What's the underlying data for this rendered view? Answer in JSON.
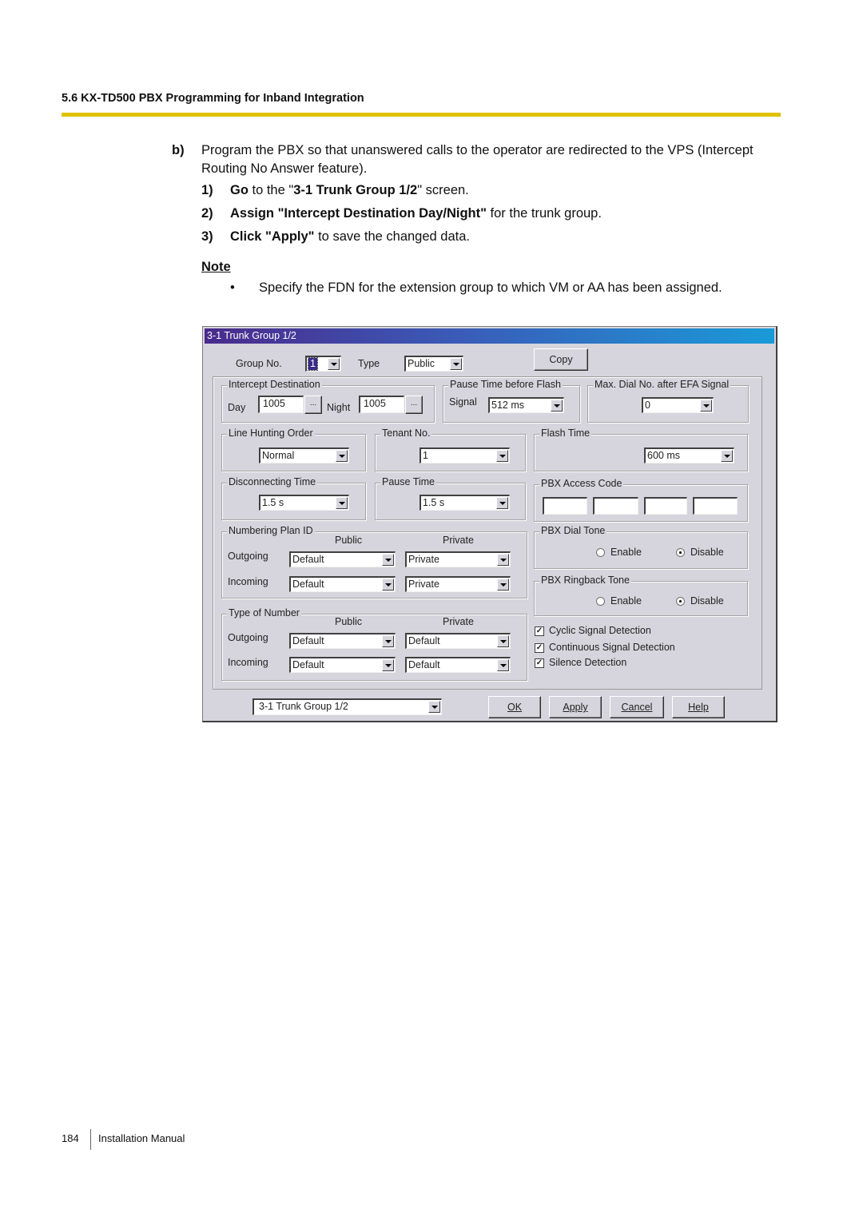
{
  "header": {
    "section_title": "5.6 KX-TD500 PBX Programming for Inband Integration",
    "rule_color": "#dfc100"
  },
  "instruction": {
    "label": "b)",
    "text": "Program the PBX so that unanswered calls to the operator are redirected to the VPS (Intercept Routing No Answer feature).",
    "steps": [
      {
        "num": "1)",
        "bold1": "Go",
        "plain1": " to the \"",
        "bold2": "3-1 Trunk Group 1/2",
        "plain2": "\" screen."
      },
      {
        "num": "2)",
        "bold1": "Assign \"Intercept Destination Day/Night\"",
        "plain1": " for the trunk group.",
        "bold2": "",
        "plain2": ""
      },
      {
        "num": "3)",
        "bold1": "Click \"Apply\"",
        "plain1": " to save the changed data.",
        "bold2": "",
        "plain2": ""
      }
    ],
    "note_label": "Note",
    "note_bullet": "•",
    "note_text": "Specify the FDN for the extension group to which VM or AA has been assigned."
  },
  "dialog": {
    "title": "3-1 Trunk Group 1/2",
    "group_no": {
      "label": "Group No.",
      "value": "1"
    },
    "type": {
      "label": "Type",
      "value": "Public"
    },
    "copy_button": "Copy",
    "intercept_destination": {
      "title": "Intercept Destination",
      "day_label": "Day",
      "day_value": "1005",
      "night_label": "Night",
      "night_value": "1005",
      "browse_label": "..."
    },
    "pause_time_before_flash": {
      "title": "Pause Time before Flash",
      "signal_label": "Signal",
      "value": "512 ms"
    },
    "max_dial_no": {
      "title": "Max. Dial No. after EFA Signal",
      "value": "0"
    },
    "line_hunting_order": {
      "title": "Line Hunting Order",
      "value": "Normal"
    },
    "tenant_no": {
      "title": "Tenant No.",
      "value": "1"
    },
    "flash_time": {
      "title": "Flash Time",
      "value": "600 ms"
    },
    "disconnecting_time": {
      "title": "Disconnecting Time",
      "value": "1.5 s"
    },
    "pause_time": {
      "title": "Pause Time",
      "value": "1.5 s"
    },
    "pbx_access_code": {
      "title": "PBX Access Code",
      "values": [
        "",
        "",
        "",
        ""
      ]
    },
    "numbering_plan_id": {
      "title": "Numbering Plan ID",
      "col_public": "Public",
      "col_private": "Private",
      "outgoing_label": "Outgoing",
      "incoming_label": "Incoming",
      "outgoing_public": "Default",
      "outgoing_private": "Private",
      "incoming_public": "Default",
      "incoming_private": "Private"
    },
    "type_of_number": {
      "title": "Type of Number",
      "col_public": "Public",
      "col_private": "Private",
      "outgoing_label": "Outgoing",
      "incoming_label": "Incoming",
      "outgoing_public": "Default",
      "outgoing_private": "Default",
      "incoming_public": "Default",
      "incoming_private": "Default"
    },
    "pbx_dial_tone": {
      "title": "PBX Dial Tone",
      "enable": "Enable",
      "disable": "Disable",
      "selected": "Disable"
    },
    "pbx_ringback_tone": {
      "title": "PBX Ringback Tone",
      "enable": "Enable",
      "disable": "Disable",
      "selected": "Disable"
    },
    "checkboxes": [
      {
        "label": "Cyclic Signal Detection",
        "checked": true
      },
      {
        "label": "Continuous Signal Detection",
        "checked": true
      },
      {
        "label": "Silence Detection",
        "checked": true
      }
    ],
    "screen_selector": "3-1 Trunk Group 1/2",
    "buttons": {
      "ok": "OK",
      "apply": "Apply",
      "cancel": "Cancel",
      "help": "Help"
    }
  },
  "footer": {
    "page_number": "184",
    "manual_title": "Installation Manual"
  }
}
